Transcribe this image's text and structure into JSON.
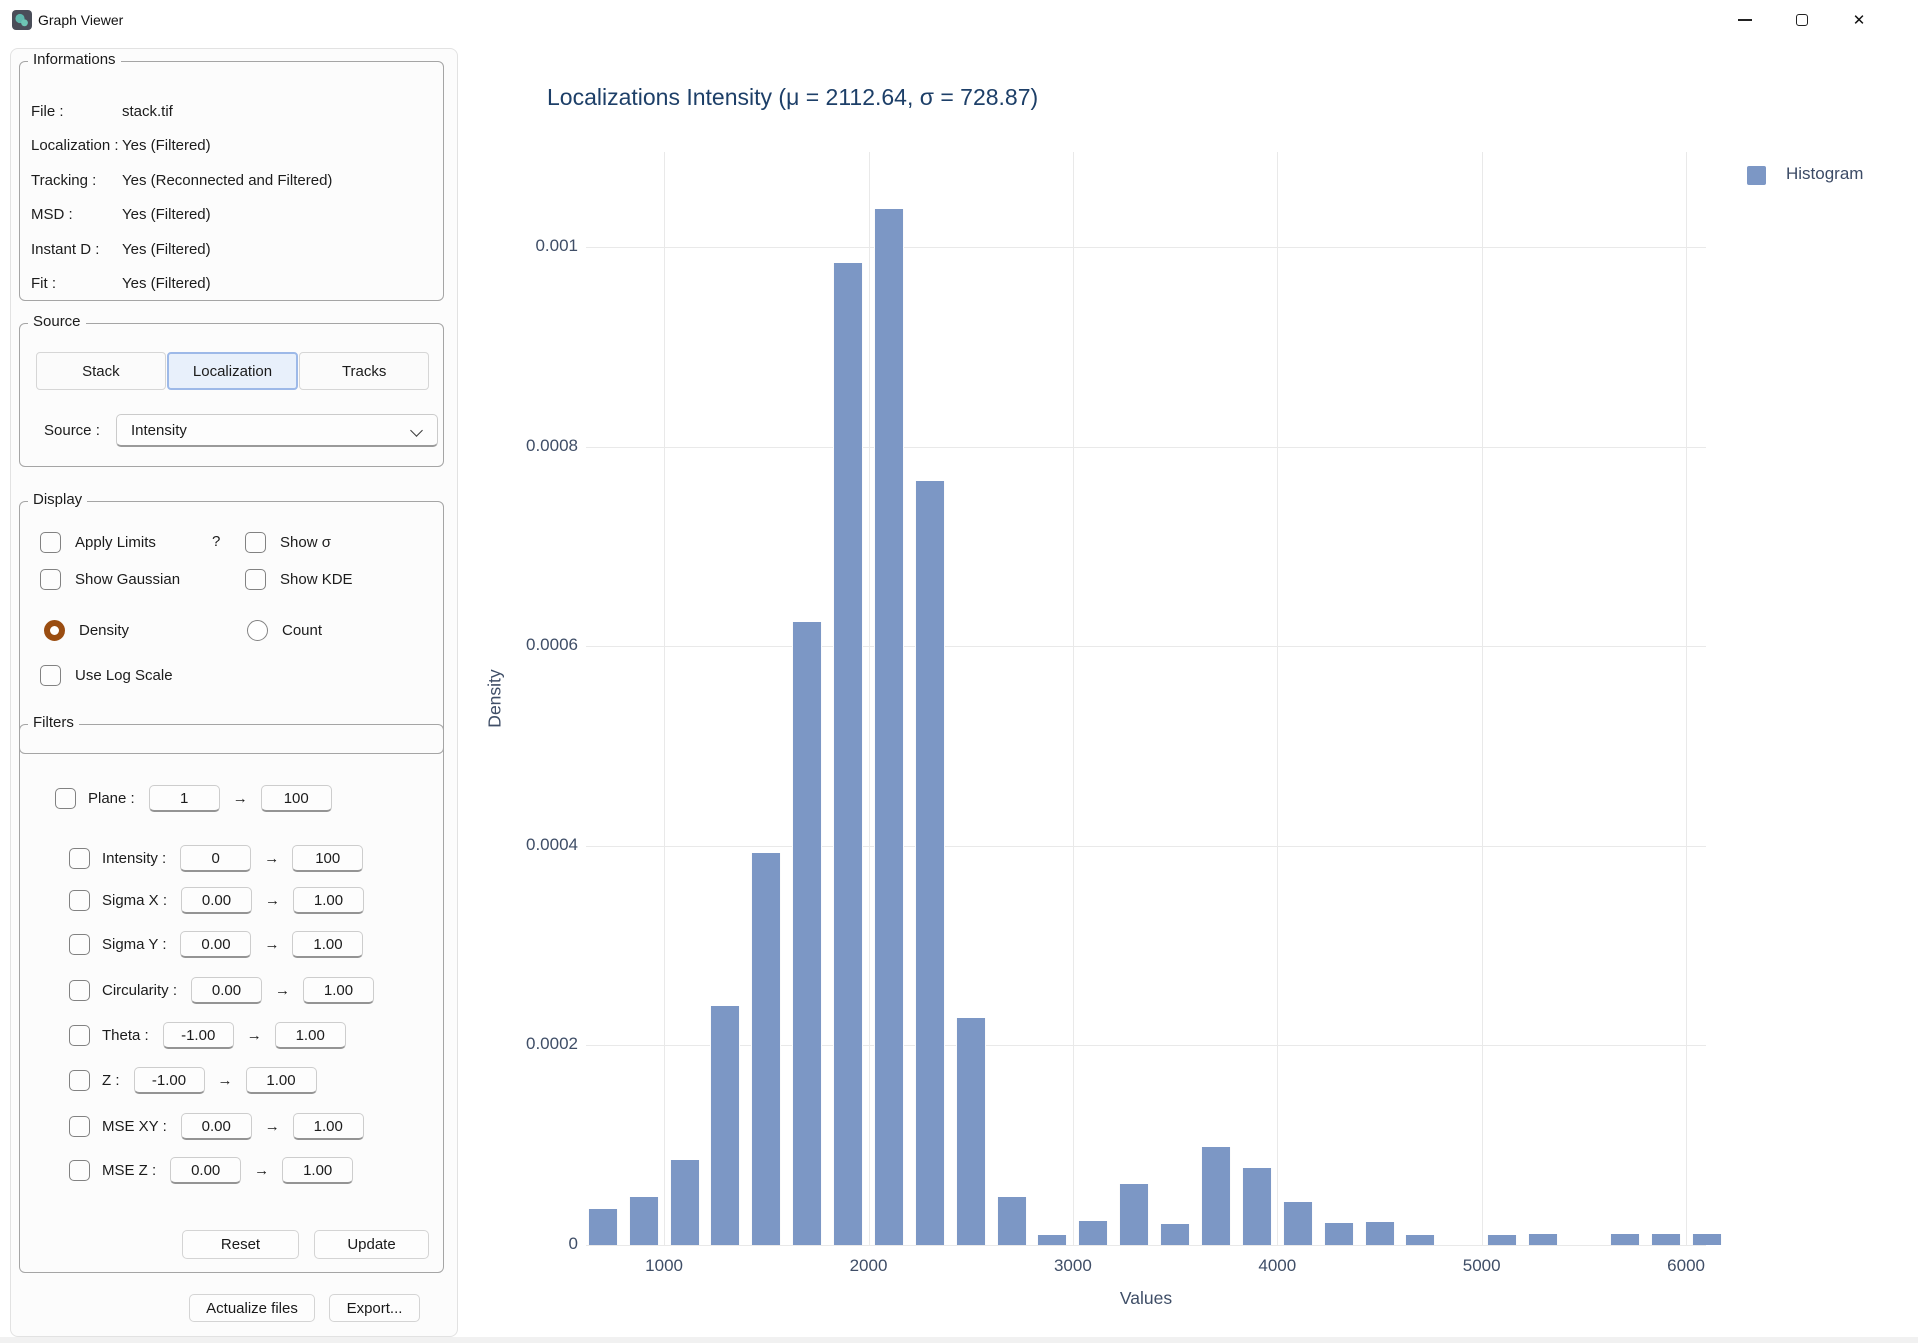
{
  "window": {
    "title": "Graph Viewer"
  },
  "sidebar": {
    "informations": {
      "legend": "Informations",
      "rows": [
        {
          "label": "File :",
          "value": "stack.tif"
        },
        {
          "label": "Localization :",
          "value": "Yes (Filtered)"
        },
        {
          "label": "Tracking :",
          "value": "Yes (Reconnected and Filtered)"
        },
        {
          "label": "MSD :",
          "value": "Yes (Filtered)"
        },
        {
          "label": "Instant D :",
          "value": "Yes (Filtered)"
        },
        {
          "label": "Fit :",
          "value": "Yes (Filtered)"
        }
      ]
    },
    "source": {
      "legend": "Source",
      "buttons": [
        "Stack",
        "Localization",
        "Tracks"
      ],
      "selected": "Localization",
      "source_label": "Source :",
      "source_value": "Intensity"
    },
    "display": {
      "legend": "Display",
      "apply_limits": "Apply Limits",
      "help": "?",
      "show_sigma": "Show σ",
      "show_gaussian": "Show Gaussian",
      "show_kde": "Show KDE",
      "density": "Density",
      "count": "Count",
      "use_log_scale": "Use Log Scale",
      "selected_radio": "Density"
    },
    "filters": {
      "legend": "Filters",
      "arrow": "→",
      "rows": [
        {
          "label": "Plane :",
          "from": "1",
          "to": "100"
        },
        {
          "label": "Intensity :",
          "from": "0",
          "to": "100"
        },
        {
          "label": "Sigma X :",
          "from": "0.00",
          "to": "1.00"
        },
        {
          "label": "Sigma Y :",
          "from": "0.00",
          "to": "1.00"
        },
        {
          "label": "Circularity :",
          "from": "0.00",
          "to": "1.00"
        },
        {
          "label": "Theta :",
          "from": "-1.00",
          "to": "1.00"
        },
        {
          "label": "Z :",
          "from": "-1.00",
          "to": "1.00"
        },
        {
          "label": "MSE XY :",
          "from": "0.00",
          "to": "1.00"
        },
        {
          "label": "MSE Z :",
          "from": "0.00",
          "to": "1.00"
        }
      ],
      "reset": "Reset",
      "update": "Update"
    },
    "actions": {
      "actualize": "Actualize files",
      "export": "Export..."
    }
  },
  "chart_data": {
    "type": "bar",
    "title": "Localizations Intensity (μ = 2112.64, σ = 728.87)",
    "xlabel": "Values",
    "ylabel": "Density",
    "legend": [
      {
        "label": "Histogram",
        "color": "#7c97c5"
      }
    ],
    "legend_position": "top-right",
    "grid": true,
    "bin_width": 200,
    "centers": [
      700,
      900,
      1100,
      1300,
      1500,
      1700,
      1900,
      2100,
      2300,
      2500,
      2700,
      2900,
      3100,
      3300,
      3500,
      3700,
      3900,
      4100,
      4300,
      4500,
      4700,
      4900,
      5100,
      5300,
      5500,
      5700,
      5900,
      6100
    ],
    "densities": [
      3.6e-05,
      4.8e-05,
      8.5e-05,
      0.00024,
      0.000393,
      0.000624,
      0.000984,
      0.001038,
      0.000766,
      0.000228,
      4.8e-05,
      1e-05,
      2.4e-05,
      6.1e-05,
      2.1e-05,
      9.8e-05,
      7.7e-05,
      4.3e-05,
      2.2e-05,
      2.3e-05,
      1e-05,
      0,
      1e-05,
      1.1e-05,
      0,
      1.1e-05,
      1.1e-05,
      1.1e-05
    ],
    "x_ticks": [
      "1000",
      "2000",
      "3000",
      "4000",
      "5000",
      "6000"
    ],
    "x_tick_values": [
      1000,
      2000,
      3000,
      4000,
      5000,
      6000
    ],
    "y_ticks": [
      "0",
      "0.0002",
      "0.0004",
      "0.0006",
      "0.0008",
      "0.001"
    ],
    "y_tick_values": [
      0,
      0.0002,
      0.0004,
      0.0006,
      0.0008,
      0.001
    ],
    "xlim": [
      620,
      6100
    ],
    "ylim": [
      0,
      0.0011
    ]
  },
  "colors": {
    "bar": "#7c97c5",
    "selected_button_bg": "#e8f0fb",
    "selected_button_border": "#9db9e8",
    "radio_accent": "#9a4d11",
    "chart_text": "#3f4e67",
    "title_text": "#1d3f68",
    "grid": "#e9e9e9"
  }
}
